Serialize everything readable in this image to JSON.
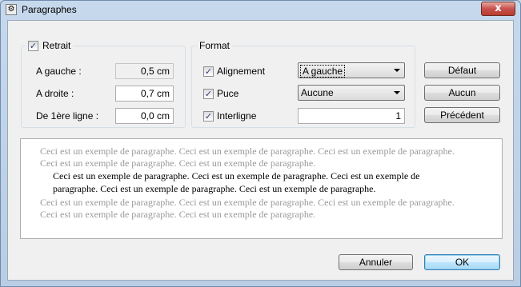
{
  "window": {
    "title": "Paragraphes",
    "close_glyph": "x"
  },
  "retrait": {
    "caption": "Retrait",
    "checked": true,
    "rows": [
      {
        "label": "A gauche :",
        "value": "0,5 cm",
        "disabled": true
      },
      {
        "label": "A droite :",
        "value": "0,7 cm",
        "disabled": false
      },
      {
        "label": "De 1ère ligne :",
        "value": "0,0 cm",
        "disabled": false
      }
    ]
  },
  "format": {
    "caption": "Format",
    "rows": [
      {
        "label": "Alignement",
        "checked": true,
        "value": "A gauche"
      },
      {
        "label": "Puce",
        "checked": true,
        "value": "Aucune"
      },
      {
        "label": "Interligne",
        "checked": true,
        "value": "1"
      }
    ]
  },
  "side_buttons": {
    "defaut": "Défaut",
    "aucun": "Aucun",
    "precedent": "Précédent"
  },
  "preview": {
    "before": [
      "Ceci est un exemple de paragraphe. Ceci est un exemple de paragraphe. Ceci est un exemple de paragraphe.",
      "Ceci est un exemple de paragraphe. Ceci est un exemple de paragraphe."
    ],
    "current": [
      "Ceci est un exemple de paragraphe. Ceci est un exemple de paragraphe. Ceci est un exemple de",
      "paragraphe. Ceci est un exemple de paragraphe. Ceci est un exemple de paragraphe."
    ],
    "after": [
      "Ceci est un exemple de paragraphe. Ceci est un exemple de paragraphe. Ceci est un exemple de paragraphe.",
      "Ceci est un exemple de paragraphe. Ceci est un exemple de paragraphe."
    ]
  },
  "footer": {
    "cancel": "Annuler",
    "ok": "OK"
  },
  "check_glyph": "✓"
}
